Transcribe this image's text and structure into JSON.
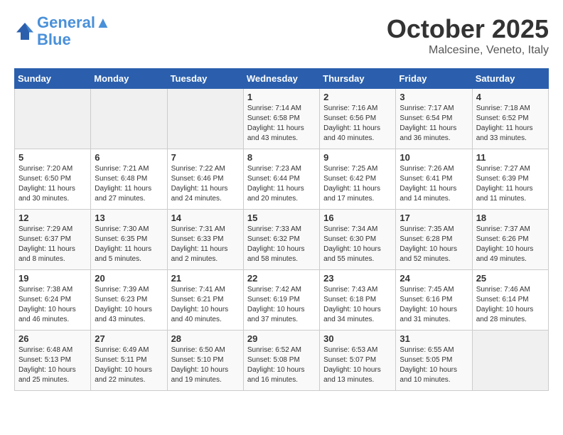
{
  "header": {
    "logo_line1": "General",
    "logo_line2": "Blue",
    "month": "October 2025",
    "location": "Malcesine, Veneto, Italy"
  },
  "weekdays": [
    "Sunday",
    "Monday",
    "Tuesday",
    "Wednesday",
    "Thursday",
    "Friday",
    "Saturday"
  ],
  "weeks": [
    [
      {
        "day": "",
        "info": ""
      },
      {
        "day": "",
        "info": ""
      },
      {
        "day": "",
        "info": ""
      },
      {
        "day": "1",
        "info": "Sunrise: 7:14 AM\nSunset: 6:58 PM\nDaylight: 11 hours\nand 43 minutes."
      },
      {
        "day": "2",
        "info": "Sunrise: 7:16 AM\nSunset: 6:56 PM\nDaylight: 11 hours\nand 40 minutes."
      },
      {
        "day": "3",
        "info": "Sunrise: 7:17 AM\nSunset: 6:54 PM\nDaylight: 11 hours\nand 36 minutes."
      },
      {
        "day": "4",
        "info": "Sunrise: 7:18 AM\nSunset: 6:52 PM\nDaylight: 11 hours\nand 33 minutes."
      }
    ],
    [
      {
        "day": "5",
        "info": "Sunrise: 7:20 AM\nSunset: 6:50 PM\nDaylight: 11 hours\nand 30 minutes."
      },
      {
        "day": "6",
        "info": "Sunrise: 7:21 AM\nSunset: 6:48 PM\nDaylight: 11 hours\nand 27 minutes."
      },
      {
        "day": "7",
        "info": "Sunrise: 7:22 AM\nSunset: 6:46 PM\nDaylight: 11 hours\nand 24 minutes."
      },
      {
        "day": "8",
        "info": "Sunrise: 7:23 AM\nSunset: 6:44 PM\nDaylight: 11 hours\nand 20 minutes."
      },
      {
        "day": "9",
        "info": "Sunrise: 7:25 AM\nSunset: 6:42 PM\nDaylight: 11 hours\nand 17 minutes."
      },
      {
        "day": "10",
        "info": "Sunrise: 7:26 AM\nSunset: 6:41 PM\nDaylight: 11 hours\nand 14 minutes."
      },
      {
        "day": "11",
        "info": "Sunrise: 7:27 AM\nSunset: 6:39 PM\nDaylight: 11 hours\nand 11 minutes."
      }
    ],
    [
      {
        "day": "12",
        "info": "Sunrise: 7:29 AM\nSunset: 6:37 PM\nDaylight: 11 hours\nand 8 minutes."
      },
      {
        "day": "13",
        "info": "Sunrise: 7:30 AM\nSunset: 6:35 PM\nDaylight: 11 hours\nand 5 minutes."
      },
      {
        "day": "14",
        "info": "Sunrise: 7:31 AM\nSunset: 6:33 PM\nDaylight: 11 hours\nand 2 minutes."
      },
      {
        "day": "15",
        "info": "Sunrise: 7:33 AM\nSunset: 6:32 PM\nDaylight: 10 hours\nand 58 minutes."
      },
      {
        "day": "16",
        "info": "Sunrise: 7:34 AM\nSunset: 6:30 PM\nDaylight: 10 hours\nand 55 minutes."
      },
      {
        "day": "17",
        "info": "Sunrise: 7:35 AM\nSunset: 6:28 PM\nDaylight: 10 hours\nand 52 minutes."
      },
      {
        "day": "18",
        "info": "Sunrise: 7:37 AM\nSunset: 6:26 PM\nDaylight: 10 hours\nand 49 minutes."
      }
    ],
    [
      {
        "day": "19",
        "info": "Sunrise: 7:38 AM\nSunset: 6:24 PM\nDaylight: 10 hours\nand 46 minutes."
      },
      {
        "day": "20",
        "info": "Sunrise: 7:39 AM\nSunset: 6:23 PM\nDaylight: 10 hours\nand 43 minutes."
      },
      {
        "day": "21",
        "info": "Sunrise: 7:41 AM\nSunset: 6:21 PM\nDaylight: 10 hours\nand 40 minutes."
      },
      {
        "day": "22",
        "info": "Sunrise: 7:42 AM\nSunset: 6:19 PM\nDaylight: 10 hours\nand 37 minutes."
      },
      {
        "day": "23",
        "info": "Sunrise: 7:43 AM\nSunset: 6:18 PM\nDaylight: 10 hours\nand 34 minutes."
      },
      {
        "day": "24",
        "info": "Sunrise: 7:45 AM\nSunset: 6:16 PM\nDaylight: 10 hours\nand 31 minutes."
      },
      {
        "day": "25",
        "info": "Sunrise: 7:46 AM\nSunset: 6:14 PM\nDaylight: 10 hours\nand 28 minutes."
      }
    ],
    [
      {
        "day": "26",
        "info": "Sunrise: 6:48 AM\nSunset: 5:13 PM\nDaylight: 10 hours\nand 25 minutes."
      },
      {
        "day": "27",
        "info": "Sunrise: 6:49 AM\nSunset: 5:11 PM\nDaylight: 10 hours\nand 22 minutes."
      },
      {
        "day": "28",
        "info": "Sunrise: 6:50 AM\nSunset: 5:10 PM\nDaylight: 10 hours\nand 19 minutes."
      },
      {
        "day": "29",
        "info": "Sunrise: 6:52 AM\nSunset: 5:08 PM\nDaylight: 10 hours\nand 16 minutes."
      },
      {
        "day": "30",
        "info": "Sunrise: 6:53 AM\nSunset: 5:07 PM\nDaylight: 10 hours\nand 13 minutes."
      },
      {
        "day": "31",
        "info": "Sunrise: 6:55 AM\nSunset: 5:05 PM\nDaylight: 10 hours\nand 10 minutes."
      },
      {
        "day": "",
        "info": ""
      }
    ]
  ]
}
